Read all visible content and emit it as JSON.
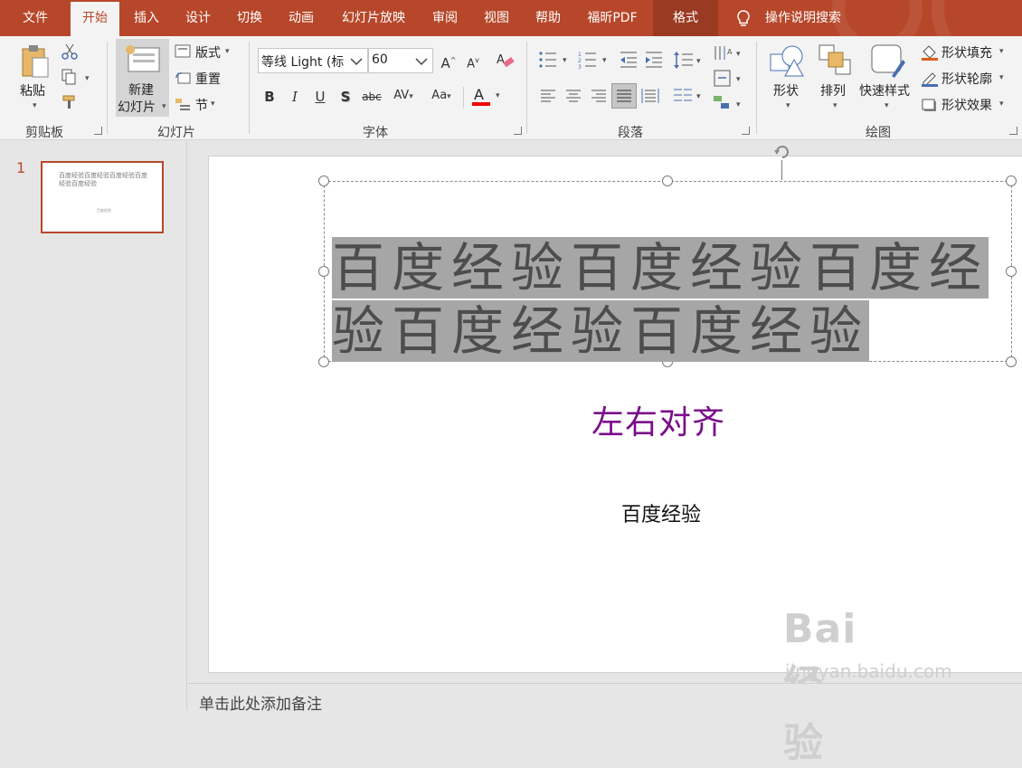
{
  "tabs": [
    "文件",
    "开始",
    "插入",
    "设计",
    "切换",
    "动画",
    "幻灯片放映",
    "审阅",
    "视图",
    "帮助",
    "福昕PDF",
    "格式"
  ],
  "active_tab": "开始",
  "tell_me": "操作说明搜索",
  "clipboard": {
    "paste": "粘贴",
    "group": "剪贴板"
  },
  "slides_group": {
    "new_slide_line1": "新建",
    "new_slide_line2": "幻灯片",
    "layout": "版式",
    "reset": "重置",
    "section": "节",
    "group": "幻灯片"
  },
  "font_group": {
    "font_name": "等线 Light (标",
    "font_size": "60",
    "group": "字体"
  },
  "paragraph_group": {
    "group": "段落"
  },
  "drawing_group": {
    "shapes": "形状",
    "arrange": "排列",
    "quick_styles": "快速样式",
    "fill": "形状填充",
    "outline": "形状轮廓",
    "effects": "形状效果",
    "group": "绘图"
  },
  "thumbnail": {
    "number": "1",
    "title": "百度经验百度经验百度经验百度经验百度经验",
    "subtitle": "百度经验"
  },
  "slide": {
    "title": "百度经验百度经验百度经验百度经验百度经验",
    "subtitle1": "左右对齐",
    "subtitle2": "百度经验"
  },
  "notes_placeholder": "单击此处添加备注",
  "watermark": {
    "main": "Bai经验",
    "sub": "jingyan.baidu.com"
  },
  "colors": {
    "accent": "#b7472a",
    "subtitle": "#7a0e8a",
    "selection": "#a6a6a6"
  }
}
